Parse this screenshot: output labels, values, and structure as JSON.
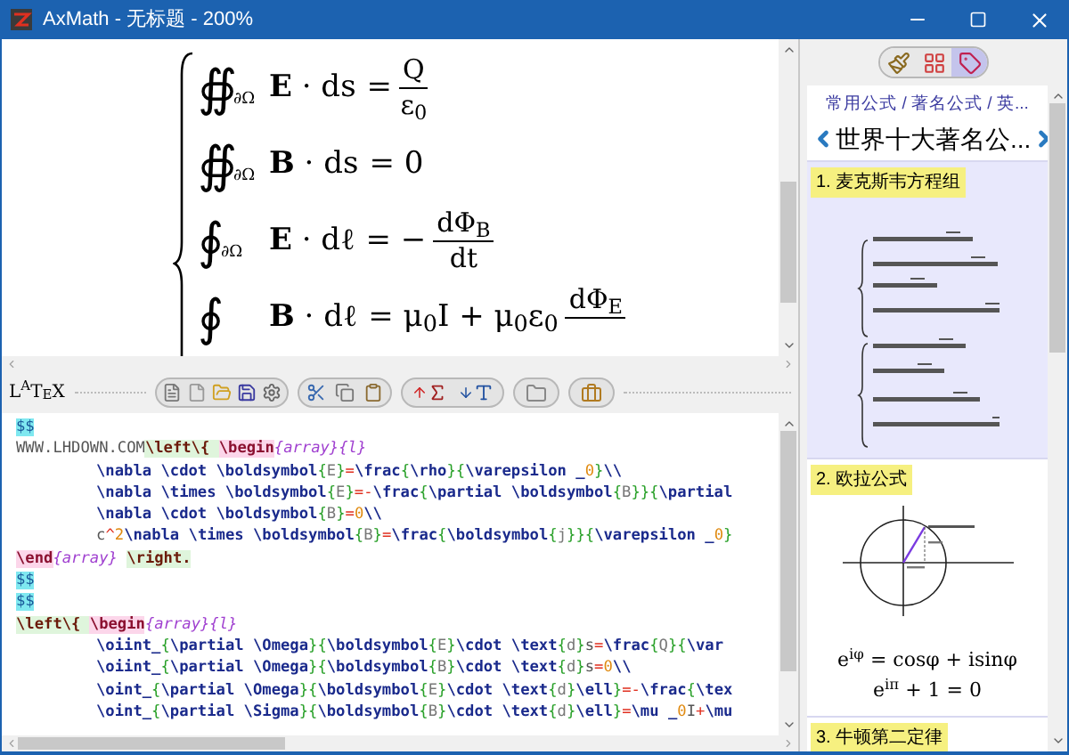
{
  "window": {
    "title": "AxMath - 无标题 - 200%"
  },
  "preview": {
    "equations": [
      {
        "integral": "∯",
        "sub": "∂Ω",
        "lhs": "**E** · ds",
        "rhs": [
          {
            "kind": "text",
            "text": "="
          },
          {
            "kind": "fraction",
            "num": "Q",
            "den": "ε$_{0}$"
          }
        ]
      },
      {
        "integral": "∯",
        "sub": "∂Ω",
        "lhs": "**B** · ds",
        "rhs": [
          {
            "kind": "text",
            "text": "= 0"
          }
        ]
      },
      {
        "integral": "∮",
        "sub": "∂Ω",
        "lhs": "**E** · dℓ",
        "rhs": [
          {
            "kind": "text",
            "text": "= −"
          },
          {
            "kind": "fraction",
            "num": "dΦ$_{B}$",
            "den": "dt"
          }
        ]
      },
      {
        "integral": "∮",
        "lhs": "**B** · dℓ",
        "rhs": [
          {
            "kind": "text",
            "text": "= μ$_{0}$I + μ$_{0}$ε$_{0}$"
          },
          {
            "kind": "fraction",
            "num": "dΦ$_{E}$"
          }
        ]
      }
    ]
  },
  "latex_label": "L$^{A}$T$_{E}$X",
  "editor": {
    "lines": [
      {
        "indented": false,
        "segments": [
          {
            "text": "$$",
            "kind": "delim"
          }
        ]
      },
      {
        "indented": false,
        "segments": [
          {
            "text": "WWW.LHDOWN.COM",
            "kind": "plain"
          },
          {
            "text": "\\left\\{ ",
            "kind": "left"
          },
          {
            "text": "\\begin",
            "kind": "env"
          },
          {
            "text": "{array}{l}",
            "kind": "envarg"
          }
        ]
      },
      {
        "indented": true,
        "segments": [
          {
            "text": "\\nabla \\cdot \\boldsymbol",
            "kind": "cmd"
          },
          {
            "text": "{",
            "kind": "brace"
          },
          {
            "text": "E",
            "kind": "arg"
          },
          {
            "text": "}",
            "kind": "brace"
          },
          {
            "text": "=",
            "kind": "op"
          },
          {
            "text": "\\frac",
            "kind": "cmd"
          },
          {
            "text": "{",
            "kind": "brace"
          },
          {
            "text": "\\rho",
            "kind": "cmd"
          },
          {
            "text": "}{",
            "kind": "brace"
          },
          {
            "text": "\\varepsilon _",
            "kind": "cmd"
          },
          {
            "text": "0",
            "kind": "num"
          },
          {
            "text": "}",
            "kind": "brace"
          },
          {
            "text": "\\\\",
            "kind": "cmd"
          }
        ]
      },
      {
        "indented": true,
        "segments": [
          {
            "text": "\\nabla \\times \\boldsymbol",
            "kind": "cmd"
          },
          {
            "text": "{",
            "kind": "brace"
          },
          {
            "text": "E",
            "kind": "arg"
          },
          {
            "text": "}",
            "kind": "brace"
          },
          {
            "text": "=-",
            "kind": "op"
          },
          {
            "text": "\\frac",
            "kind": "cmd"
          },
          {
            "text": "{",
            "kind": "brace"
          },
          {
            "text": "\\partial \\boldsymbol",
            "kind": "cmd"
          },
          {
            "text": "{",
            "kind": "brace"
          },
          {
            "text": "B",
            "kind": "arg"
          },
          {
            "text": "}}{",
            "kind": "brace"
          },
          {
            "text": "\\partial",
            "kind": "cmd"
          }
        ]
      },
      {
        "indented": true,
        "segments": [
          {
            "text": "\\nabla \\cdot \\boldsymbol",
            "kind": "cmd"
          },
          {
            "text": "{",
            "kind": "brace"
          },
          {
            "text": "B",
            "kind": "arg"
          },
          {
            "text": "}",
            "kind": "brace"
          },
          {
            "text": "=",
            "kind": "op"
          },
          {
            "text": "0",
            "kind": "num"
          },
          {
            "text": "\\\\",
            "kind": "cmd"
          }
        ]
      },
      {
        "indented": true,
        "segments": [
          {
            "text": "c",
            "kind": "plain"
          },
          {
            "text": "^",
            "kind": "op"
          },
          {
            "text": "2",
            "kind": "num"
          },
          {
            "text": "\\nabla \\times \\boldsymbol",
            "kind": "cmd"
          },
          {
            "text": "{",
            "kind": "brace"
          },
          {
            "text": "B",
            "kind": "arg"
          },
          {
            "text": "}",
            "kind": "brace"
          },
          {
            "text": "=",
            "kind": "op"
          },
          {
            "text": "\\frac",
            "kind": "cmd"
          },
          {
            "text": "{",
            "kind": "brace"
          },
          {
            "text": "\\boldsymbol",
            "kind": "cmd"
          },
          {
            "text": "{",
            "kind": "brace"
          },
          {
            "text": "j",
            "kind": "arg"
          },
          {
            "text": "}}{",
            "kind": "brace"
          },
          {
            "text": "\\varepsilon _",
            "kind": "cmd"
          },
          {
            "text": "0",
            "kind": "num"
          },
          {
            "text": "}",
            "kind": "brace"
          }
        ]
      },
      {
        "indented": false,
        "segments": [
          {
            "text": "\\end",
            "kind": "env"
          },
          {
            "text": "{array} ",
            "kind": "envarg"
          },
          {
            "text": "\\right.",
            "kind": "left"
          }
        ]
      },
      {
        "indented": false,
        "segments": [
          {
            "text": "$$",
            "kind": "delim"
          }
        ]
      },
      {
        "indented": false,
        "segments": [
          {
            "text": "$$",
            "kind": "delim"
          }
        ]
      },
      {
        "indented": false,
        "segments": [
          {
            "text": "\\left\\{ ",
            "kind": "left"
          },
          {
            "text": "\\begin",
            "kind": "env"
          },
          {
            "text": "{array}{l}",
            "kind": "envarg"
          }
        ]
      },
      {
        "indented": true,
        "segments": [
          {
            "text": "\\oiint_",
            "kind": "cmd"
          },
          {
            "text": "{",
            "kind": "brace"
          },
          {
            "text": "\\partial \\Omega",
            "kind": "cmd"
          },
          {
            "text": "}{",
            "kind": "brace"
          },
          {
            "text": "\\boldsymbol",
            "kind": "cmd"
          },
          {
            "text": "{",
            "kind": "brace"
          },
          {
            "text": "E",
            "kind": "arg"
          },
          {
            "text": "}",
            "kind": "brace"
          },
          {
            "text": "\\cdot \\text",
            "kind": "cmd"
          },
          {
            "text": "{",
            "kind": "brace"
          },
          {
            "text": "d",
            "kind": "arg"
          },
          {
            "text": "}",
            "kind": "brace"
          },
          {
            "text": "s",
            "kind": "plain"
          },
          {
            "text": "=",
            "kind": "op"
          },
          {
            "text": "\\frac",
            "kind": "cmd"
          },
          {
            "text": "{",
            "kind": "brace"
          },
          {
            "text": "Q",
            "kind": "arg"
          },
          {
            "text": "}{",
            "kind": "brace"
          },
          {
            "text": "\\var",
            "kind": "cmd"
          }
        ]
      },
      {
        "indented": true,
        "segments": [
          {
            "text": "\\oiint_",
            "kind": "cmd"
          },
          {
            "text": "{",
            "kind": "brace"
          },
          {
            "text": "\\partial \\Omega",
            "kind": "cmd"
          },
          {
            "text": "}{",
            "kind": "brace"
          },
          {
            "text": "\\boldsymbol",
            "kind": "cmd"
          },
          {
            "text": "{",
            "kind": "brace"
          },
          {
            "text": "B",
            "kind": "arg"
          },
          {
            "text": "}",
            "kind": "brace"
          },
          {
            "text": "\\cdot \\text",
            "kind": "cmd"
          },
          {
            "text": "{",
            "kind": "brace"
          },
          {
            "text": "d",
            "kind": "arg"
          },
          {
            "text": "}",
            "kind": "brace"
          },
          {
            "text": "s",
            "kind": "plain"
          },
          {
            "text": "=",
            "kind": "op"
          },
          {
            "text": "0",
            "kind": "num"
          },
          {
            "text": "\\\\",
            "kind": "cmd"
          }
        ]
      },
      {
        "indented": true,
        "segments": [
          {
            "text": "\\oint_",
            "kind": "cmd"
          },
          {
            "text": "{",
            "kind": "brace"
          },
          {
            "text": "\\partial \\Omega",
            "kind": "cmd"
          },
          {
            "text": "}{",
            "kind": "brace"
          },
          {
            "text": "\\boldsymbol",
            "kind": "cmd"
          },
          {
            "text": "{",
            "kind": "brace"
          },
          {
            "text": "E",
            "kind": "arg"
          },
          {
            "text": "}",
            "kind": "brace"
          },
          {
            "text": "\\cdot \\text",
            "kind": "cmd"
          },
          {
            "text": "{",
            "kind": "brace"
          },
          {
            "text": "d",
            "kind": "arg"
          },
          {
            "text": "}",
            "kind": "brace"
          },
          {
            "text": "\\ell",
            "kind": "cmd"
          },
          {
            "text": "}",
            "kind": "brace"
          },
          {
            "text": "=-",
            "kind": "op"
          },
          {
            "text": "\\frac",
            "kind": "cmd"
          },
          {
            "text": "{",
            "kind": "brace"
          },
          {
            "text": "\\tex",
            "kind": "cmd"
          }
        ]
      },
      {
        "indented": true,
        "segments": [
          {
            "text": "\\oint_",
            "kind": "cmd"
          },
          {
            "text": "{",
            "kind": "brace"
          },
          {
            "text": "\\partial \\Sigma",
            "kind": "cmd"
          },
          {
            "text": "}{",
            "kind": "brace"
          },
          {
            "text": "\\boldsymbol",
            "kind": "cmd"
          },
          {
            "text": "{",
            "kind": "brace"
          },
          {
            "text": "B",
            "kind": "arg"
          },
          {
            "text": "}",
            "kind": "brace"
          },
          {
            "text": "\\cdot \\text",
            "kind": "cmd"
          },
          {
            "text": "{",
            "kind": "brace"
          },
          {
            "text": "d",
            "kind": "arg"
          },
          {
            "text": "}",
            "kind": "brace"
          },
          {
            "text": "\\ell",
            "kind": "cmd"
          },
          {
            "text": "}",
            "kind": "brace"
          },
          {
            "text": "=",
            "kind": "op"
          },
          {
            "text": "\\mu _",
            "kind": "cmd"
          },
          {
            "text": "0",
            "kind": "num"
          },
          {
            "text": "I",
            "kind": "plain"
          },
          {
            "text": "+",
            "kind": "op"
          },
          {
            "text": "\\mu",
            "kind": "cmd"
          }
        ]
      }
    ]
  },
  "panel": {
    "tabs": [
      {
        "kind": "brush",
        "selected": false
      },
      {
        "kind": "grid",
        "selected": false
      },
      {
        "kind": "tag",
        "selected": true
      }
    ],
    "breadcrumb": "常用公式 / 著名公式 / 英...",
    "title": "世界十大著名公...",
    "sections": [
      {
        "title": "1. 麦克斯韦方程组",
        "selected": true,
        "kind": "formula-images"
      },
      {
        "title": "2. 欧拉公式",
        "selected": false,
        "kind": "euler",
        "formulas": [
          "e$^{iφ}$ = cosφ + isinφ",
          "e$^{iπ}$ + 1 = 0"
        ]
      },
      {
        "title": "3. 牛顿第二定律",
        "selected": false,
        "kind": "none"
      }
    ]
  }
}
